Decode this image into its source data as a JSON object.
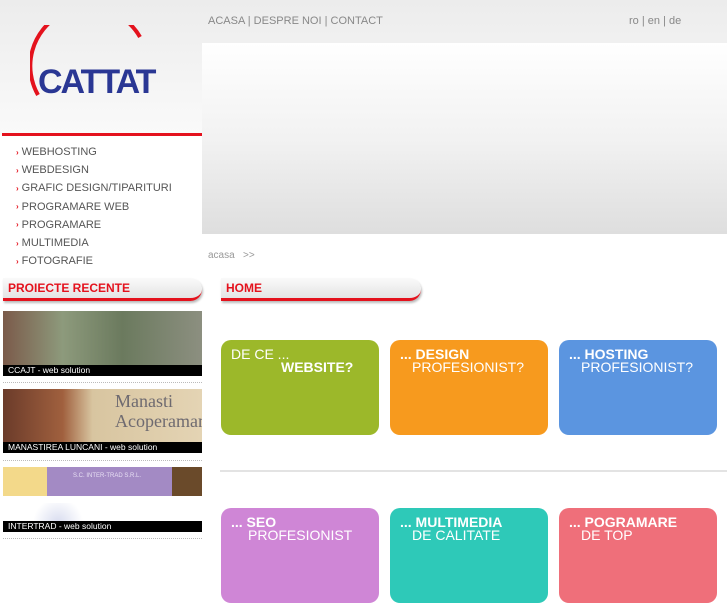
{
  "logo": {
    "text": "CATTAT"
  },
  "topnav": [
    "ACASA",
    "DESPRE NOI",
    "CONTACT"
  ],
  "lang": [
    "ro",
    "en",
    "de"
  ],
  "menu": [
    "WEBHOSTING",
    "WEBDESIGN",
    "GRAFIC DESIGN/TIPARITURI",
    "PROGRAMARE WEB",
    "PROGRAMARE",
    "MULTIMEDIA",
    "FOTOGRAFIE"
  ],
  "breadcrumb": {
    "home": "acasa",
    "sep": ">>"
  },
  "sections": {
    "recent": "PROIECTE RECENTE",
    "home": "HOME"
  },
  "projects": [
    {
      "caption": "CCAJT - web solution"
    },
    {
      "caption": "MANASTIREA LUNCANI - web solution",
      "image_text": "Manasti Acoperamant"
    },
    {
      "image_text": "S.C. INTER-TRAD S.R.L."
    },
    {
      "caption": "INTERTRAD - web solution"
    }
  ],
  "tiles": [
    {
      "pre": "DE CE ...",
      "main": "WEBSITE?",
      "color": "#9cb82a"
    },
    {
      "pre": "... DESIGN",
      "main": "PROFESIONIST?",
      "color": "#f79a1e"
    },
    {
      "pre": "... HOSTING",
      "main": "PROFESIONIST?",
      "color": "#5b95e0"
    },
    {
      "pre": "... SEO",
      "main": "PROFESIONIST",
      "color": "#cf86d6"
    },
    {
      "pre": "... MULTIMEDIA",
      "main": "DE CALITATE",
      "color": "#2ec9b8"
    },
    {
      "pre": "... POGRAMARE",
      "main": "DE TOP",
      "color": "#ef6f7a"
    }
  ]
}
